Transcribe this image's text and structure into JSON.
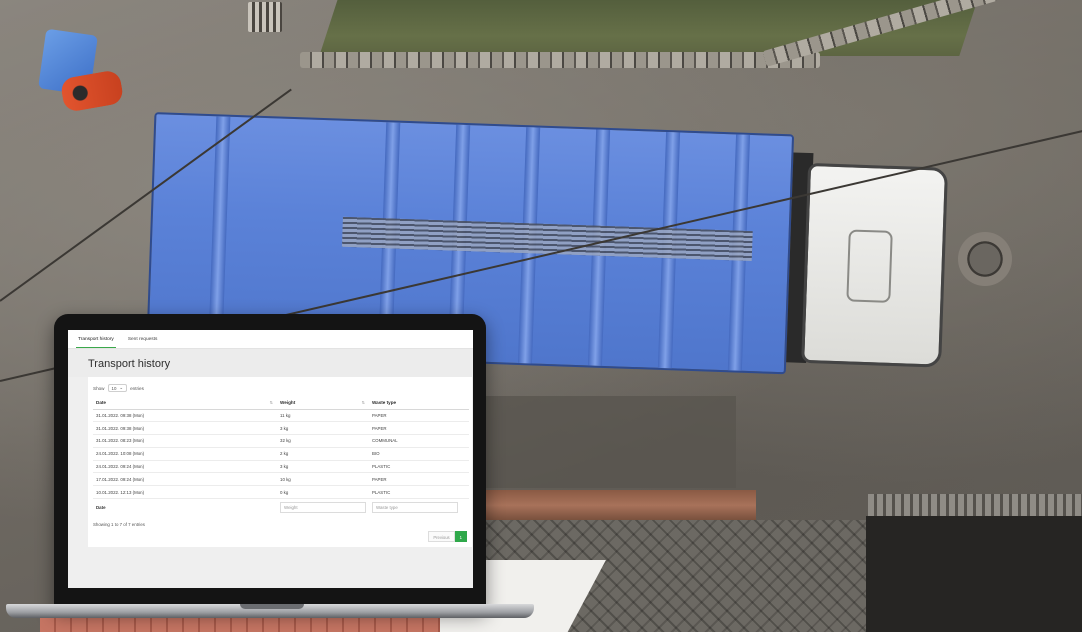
{
  "app": {
    "tabs": [
      {
        "label": "Transport history",
        "active": true
      },
      {
        "label": "Sent requests",
        "active": false
      }
    ],
    "title": "Transport history"
  },
  "table_controls": {
    "show_label": "Show",
    "page_length": "10",
    "entries_label": "entries"
  },
  "table": {
    "columns": [
      "Date",
      "Weight",
      "Waste type"
    ],
    "rows": [
      {
        "date": "31.01.2022. 09:38 (Mon)",
        "weight": "11 kg",
        "waste_type": "PAPER"
      },
      {
        "date": "31.01.2022. 09:38 (Mon)",
        "weight": "3 kg",
        "waste_type": "PAPER"
      },
      {
        "date": "31.01.2022. 08:23 (Mon)",
        "weight": "32 kg",
        "waste_type": "COMMUNAL"
      },
      {
        "date": "24.01.2022. 10:08 (Mon)",
        "weight": "2 kg",
        "waste_type": "BIO"
      },
      {
        "date": "24.01.2022. 09:24 (Mon)",
        "weight": "3 kg",
        "waste_type": "PLASTIC"
      },
      {
        "date": "17.01.2022. 09:24 (Mon)",
        "weight": "10 kg",
        "waste_type": "PAPER"
      },
      {
        "date": "10.01.2022. 12:13 (Mon)",
        "weight": "0 kg",
        "waste_type": "PLASTIC"
      }
    ],
    "filter_row": {
      "label": "Date",
      "weight_placeholder": "Weight",
      "waste_type_placeholder": "Waste type"
    }
  },
  "footer": {
    "info": "Showing 1 to 7 of 7 entries",
    "prev_label": "Previous",
    "current_page": "1"
  },
  "colors": {
    "accent": "#2fa84a",
    "truck_blue": "#5b82d8"
  }
}
